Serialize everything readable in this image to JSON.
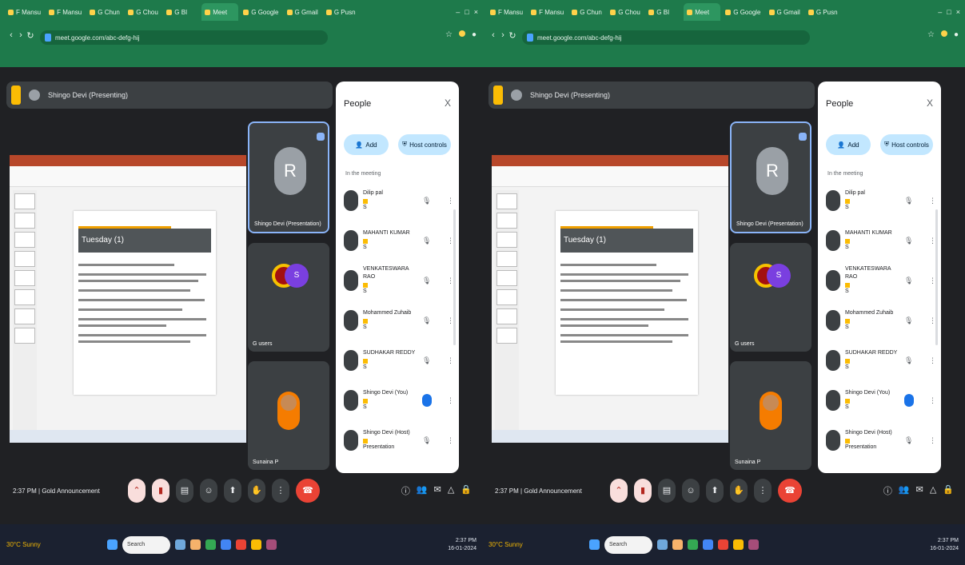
{
  "screens": [
    {
      "id": "left",
      "tabs": [
        "F Mansu",
        "F Mansu",
        "G Chun",
        "G Chou",
        "G BI",
        "Meet",
        "G Google",
        "G Gmail",
        "G Pusn"
      ],
      "active_tab": 5,
      "url": "meet.google.com/abc-defg-hij",
      "presenter_bar": "Shingo Devi (Presenting)",
      "slide_title": "Tuesday (1)",
      "tiles": [
        {
          "name": "Shingo Devi (Presentation)",
          "initial": "R",
          "type": "avatar"
        },
        {
          "name": "G users",
          "initial": "S",
          "type": "pair"
        },
        {
          "name": "Sunaina P",
          "initial": "",
          "type": "photo"
        }
      ],
      "panel": {
        "title": "People",
        "close": "X",
        "add_button": "Add",
        "host_button": "Host controls",
        "section": "In the meeting",
        "people": [
          {
            "name": "Dilip pal",
            "tag": "S"
          },
          {
            "name": "MAHANTI KUMAR",
            "tag": "S"
          },
          {
            "name": "VENKATESWARA RAO",
            "tag": "S"
          },
          {
            "name": "Mohammed Zuhaib",
            "tag": "S"
          },
          {
            "name": "SUDHAKAR REDDY",
            "tag": "S"
          },
          {
            "name": "Shingo Devi (You)",
            "tag": "S"
          },
          {
            "name": "Shingo Devi (Host)",
            "tag": "Presentation"
          }
        ]
      },
      "time": "2:37 PM | Gold Announcement",
      "weather": "30°C Sunny",
      "search": "Search",
      "clock": "2:37 PM",
      "date": "16-01-2024"
    },
    {
      "id": "right",
      "tabs": [
        "F Mansu",
        "F Mansu",
        "G Chun",
        "G Chou",
        "G BI",
        "Meet",
        "G Google",
        "G Gmail",
        "G Pusn"
      ],
      "active_tab": 5,
      "url": "meet.google.com/abc-defg-hij",
      "presenter_bar": "Shingo Devi (Presenting)",
      "slide_title": "Tuesday (1)",
      "tiles": [
        {
          "name": "Shingo Devi (Presentation)",
          "initial": "R",
          "type": "avatar"
        },
        {
          "name": "G users",
          "initial": "S",
          "type": "pair"
        },
        {
          "name": "Sunaina P",
          "initial": "",
          "type": "photo"
        }
      ],
      "panel": {
        "title": "People",
        "close": "X",
        "add_button": "Add",
        "host_button": "Host controls",
        "section": "In the meeting",
        "people": [
          {
            "name": "Dilip pal",
            "tag": "S"
          },
          {
            "name": "MAHANTI KUMAR",
            "tag": "S"
          },
          {
            "name": "VENKATESWARA RAO",
            "tag": "S"
          },
          {
            "name": "Mohammed Zuhaib",
            "tag": "S"
          },
          {
            "name": "SUDHAKAR REDDY",
            "tag": "S"
          },
          {
            "name": "Shingo Devi (You)",
            "tag": "S"
          },
          {
            "name": "Shingo Devi (Host)",
            "tag": "Presentation"
          }
        ]
      },
      "time": "2:37 PM | Gold Announcement",
      "weather": "30°C Sunny",
      "search": "Search",
      "clock": "2:37 PM",
      "date": "16-01-2024"
    }
  ],
  "controls": [
    "mic-icon",
    "camera-icon",
    "captions-icon",
    "emoji-icon",
    "present-icon",
    "raise-hand-icon",
    "more-icon",
    "end-call-icon"
  ],
  "tray_icons": [
    "info-icon",
    "people-icon",
    "chat-icon",
    "activities-icon",
    "lock-icon"
  ],
  "colors": {
    "chrome_green": "#1e7a4b",
    "meet_bg": "#202124",
    "end_red": "#ea4335",
    "accent_blue": "#c2e7ff"
  }
}
